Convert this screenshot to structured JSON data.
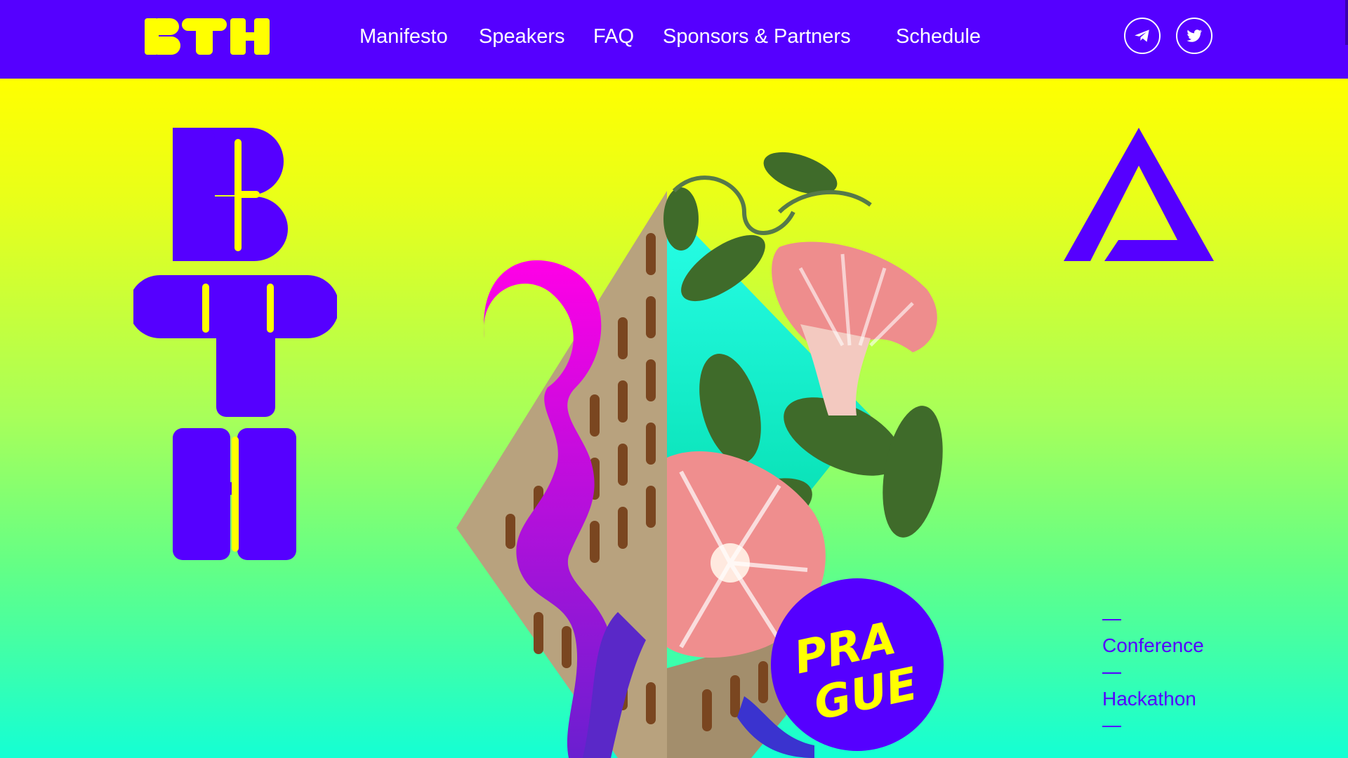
{
  "brand": {
    "logo_text": "BTH",
    "accent": "#5500ff",
    "highlight": "#ffff00"
  },
  "nav": {
    "items": [
      "Manifesto",
      "Speakers",
      "FAQ",
      "Sponsors & Partners",
      "Schedule"
    ],
    "social": [
      {
        "icon": "telegram-icon"
      },
      {
        "icon": "twitter-icon"
      }
    ]
  },
  "hero": {
    "big_letters": "BTH",
    "badge_text": "PRAGUE",
    "side_links": [
      "Conference",
      "Hackathon"
    ]
  }
}
